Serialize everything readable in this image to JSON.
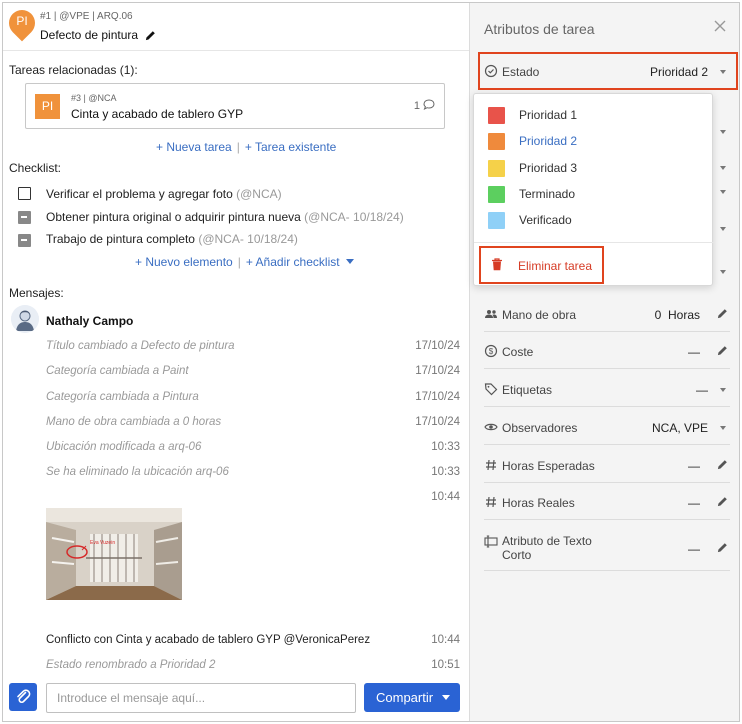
{
  "task": {
    "badge": "PI",
    "meta": "#1 | @VPE | ARQ.06",
    "title": "Defecto de pintura"
  },
  "related": {
    "label": "Tareas relacionadas (1):",
    "card": {
      "badge": "PI",
      "meta": "#3 | @NCA",
      "title": "Cinta y acabado de tablero GYP",
      "count": "1"
    },
    "links": {
      "new_task": "+ Nueva tarea",
      "existing_task": "+ Tarea existente",
      "separator": "|"
    }
  },
  "checklist": {
    "label": "Checklist:",
    "items": [
      {
        "text": "Verificar el problema y agregar foto",
        "meta": "(@NCA)",
        "state": "unchecked"
      },
      {
        "text": "Obtener pintura original o adquirir pintura nueva",
        "meta": "(@NCA- 10/18/24)",
        "state": "indeterminate"
      },
      {
        "text": "Trabajo de pintura completo",
        "meta": "(@NCA- 10/18/24)",
        "state": "indeterminate"
      }
    ],
    "links": {
      "new_item": "+ Nuevo elemento",
      "add_checklist": "+ Añadir checklist",
      "separator": "|"
    }
  },
  "messages": {
    "label": "Mensajes:",
    "author": "Nathaly Campo",
    "entries": [
      {
        "text": "Título cambiado a Defecto de pintura",
        "time": "17/10/24",
        "kind": "system"
      },
      {
        "text": "Categoría cambiada a Paint",
        "time": "17/10/24",
        "kind": "system"
      },
      {
        "text": "Categoría cambiada a Pintura",
        "time": "17/10/24",
        "kind": "system"
      },
      {
        "text": "Mano de obra cambiada a 0 horas",
        "time": "17/10/24",
        "kind": "system"
      },
      {
        "text": "Ubicación modificada a arq-06",
        "time": "10:33",
        "kind": "system"
      },
      {
        "text": "Se ha eliminado la ubicación arq-06",
        "time": "10:33",
        "kind": "system"
      },
      {
        "text": "",
        "time": "10:44",
        "kind": "photo"
      },
      {
        "text": "Conflicto con Cinta y acabado de tablero GYP @VeronicaPerez",
        "time": "10:44",
        "kind": "normal"
      },
      {
        "text": "Estado renombrado a Prioridad 2",
        "time": "10:51",
        "kind": "system"
      }
    ],
    "photo_annotation": "Eva Vuzein"
  },
  "composer": {
    "placeholder": "Introduce el mensaje aquí...",
    "send_label": "Compartir"
  },
  "attributes": {
    "title": "Atributos de tarea",
    "estado": {
      "label": "Estado",
      "value": "Prioridad 2"
    },
    "rows": [
      {
        "label": "Mano de obra",
        "value": "0  Horas",
        "control": "edit",
        "icon": "people-icon"
      },
      {
        "label": "Coste",
        "value": "—",
        "control": "edit",
        "icon": "dollar-icon"
      },
      {
        "label": "Etiquetas",
        "value": "—",
        "control": "dropdown",
        "icon": "tag-icon"
      },
      {
        "label": "Observadores",
        "value": "NCA, VPE",
        "control": "dropdown",
        "icon": "eye-icon"
      },
      {
        "label": "Horas Esperadas",
        "value": "—",
        "control": "edit",
        "icon": "hash-icon"
      },
      {
        "label": "Horas Reales",
        "value": "—",
        "control": "edit",
        "icon": "hash-icon"
      },
      {
        "label_line1": "Atributo de Texto",
        "label_line2": "Corto",
        "value": "—",
        "control": "edit",
        "icon": "text-field-icon"
      }
    ]
  },
  "status_dropdown": {
    "options": [
      {
        "label": "Prioridad 1",
        "color": "#e8534a",
        "selected": false
      },
      {
        "label": "Prioridad 2",
        "color": "#ef8a3c",
        "selected": true
      },
      {
        "label": "Prioridad 3",
        "color": "#f5d149",
        "selected": false
      },
      {
        "label": "Terminado",
        "color": "#5ccf5f",
        "selected": false
      },
      {
        "label": "Verificado",
        "color": "#8fd0f7",
        "selected": false
      }
    ],
    "delete_label": "Eliminar tarea"
  },
  "colors": {
    "accent": "#2a63d4",
    "link": "#3a6ec2",
    "badge": "#f0923b",
    "highlight": "#e0441e",
    "danger": "#d63c26"
  }
}
